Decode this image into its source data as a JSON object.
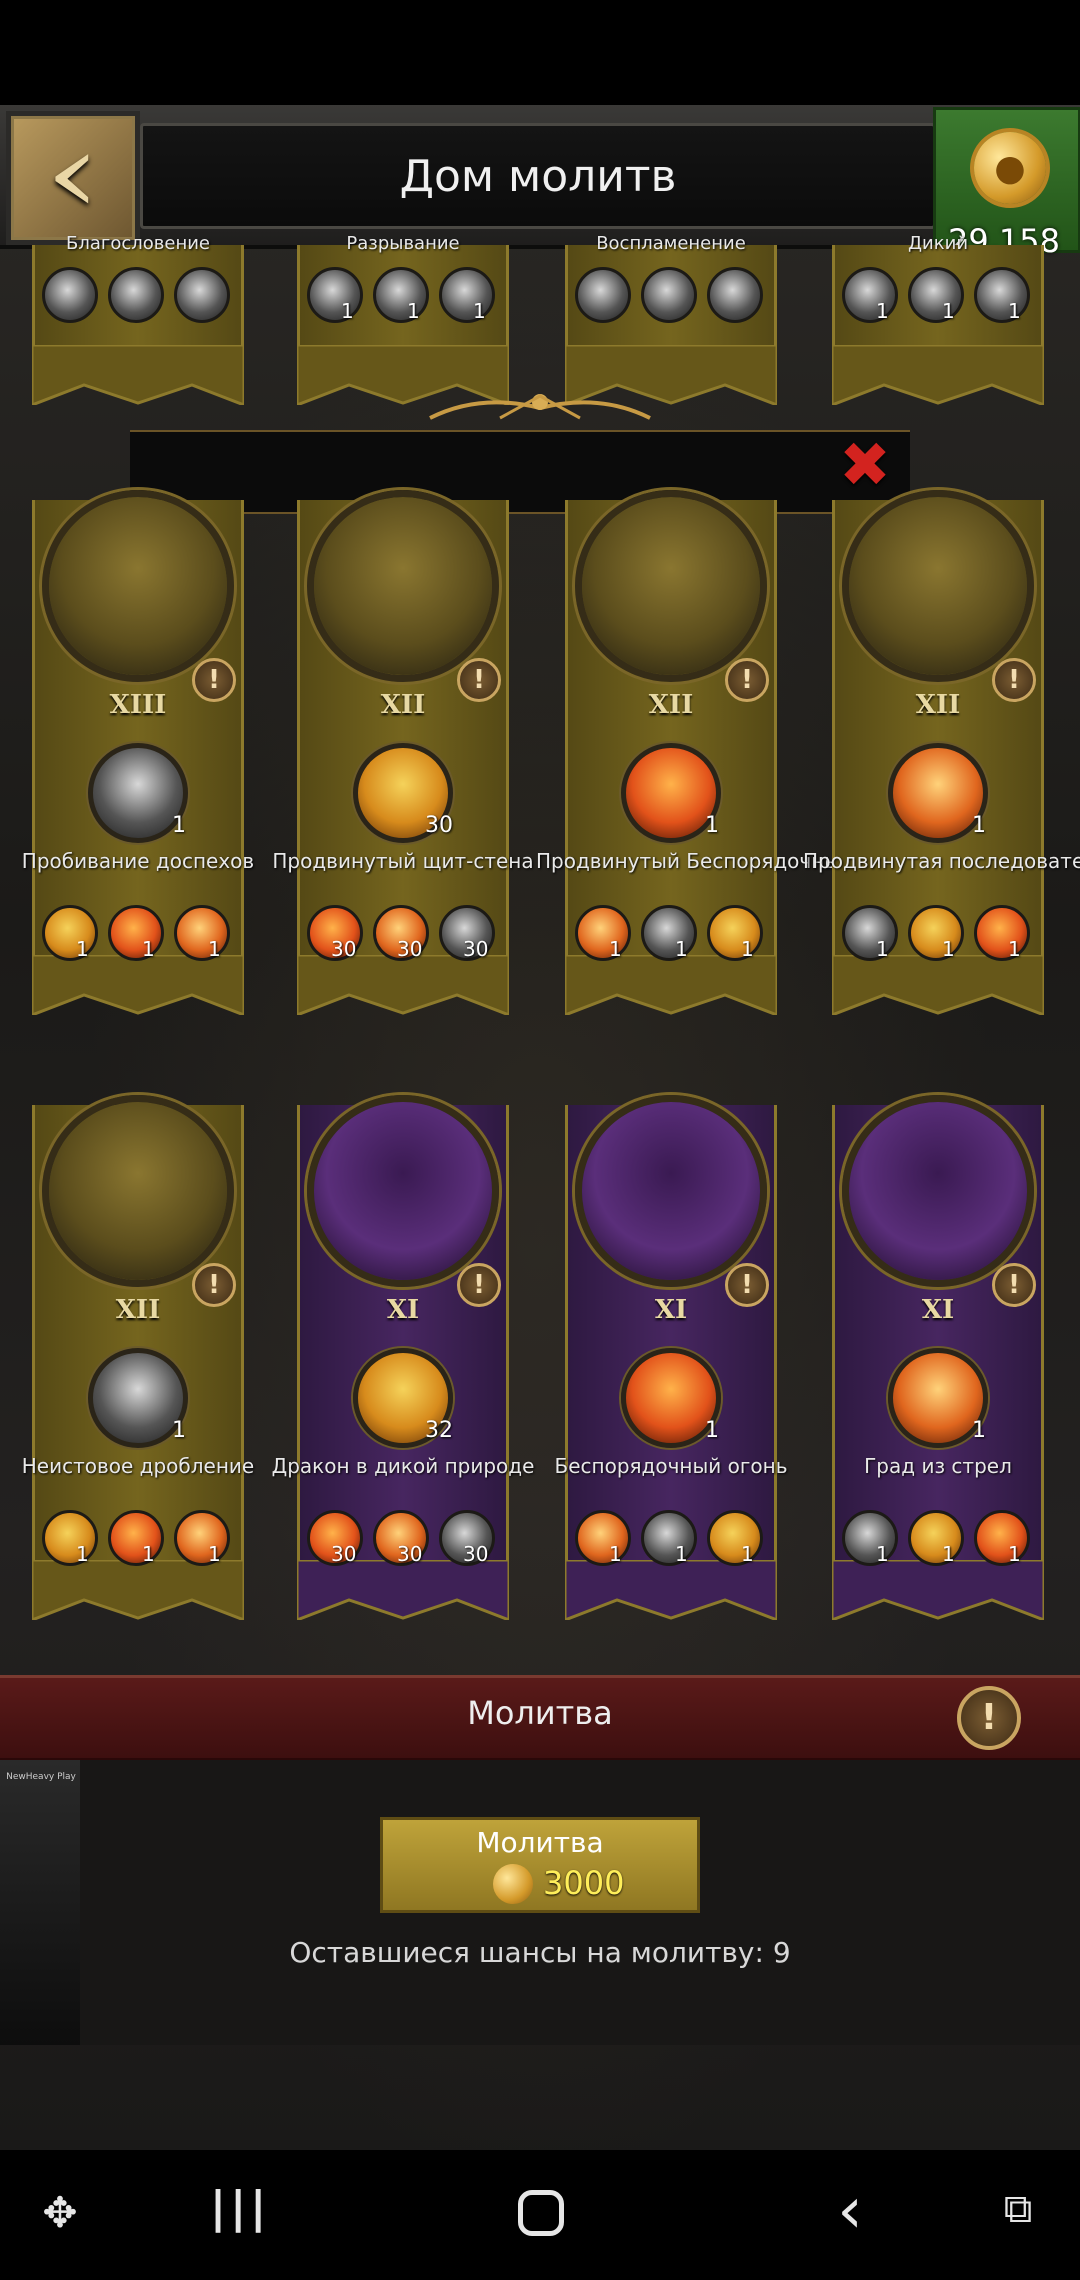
{
  "header": {
    "title": "Дом молитв",
    "gold": "29,158"
  },
  "partial_row": {
    "labels": [
      "Благословение",
      "Разрывание",
      "Воспламенение",
      "Дикий"
    ],
    "counts": [
      [
        "",
        "",
        ""
      ],
      [
        "1",
        "1",
        "1"
      ],
      [
        "",
        "",
        ""
      ],
      [
        "1",
        "1",
        "1"
      ]
    ]
  },
  "heroes": [
    {
      "level": "XIII",
      "skill": "Пробивание доспехов",
      "skill_count": "1",
      "subs": [
        "1",
        "1",
        "1"
      ],
      "theme": "gold"
    },
    {
      "level": "XII",
      "skill": "Продвинутый щит-стена",
      "skill_count": "30",
      "subs": [
        "30",
        "30",
        "30"
      ],
      "theme": "gold"
    },
    {
      "level": "XII",
      "skill": "Продвинутый Беспорядочный",
      "skill_count": "1",
      "subs": [
        "1",
        "1",
        "1"
      ],
      "theme": "gold"
    },
    {
      "level": "XII",
      "skill": "Продвинутая последовательная",
      "skill_count": "1",
      "subs": [
        "1",
        "1",
        "1"
      ],
      "theme": "gold"
    },
    {
      "level": "XII",
      "skill": "Неистовое дробление",
      "skill_count": "1",
      "subs": [
        "1",
        "1",
        "1"
      ],
      "theme": "gold"
    },
    {
      "level": "XI",
      "skill": "Дракон в дикой природе",
      "skill_count": "32",
      "subs": [
        "30",
        "30",
        "30"
      ],
      "theme": "purple"
    },
    {
      "level": "XI",
      "skill": "Беспорядочный огонь",
      "skill_count": "1",
      "subs": [
        "1",
        "1",
        "1"
      ],
      "theme": "purple"
    },
    {
      "level": "XI",
      "skill": "Град из стрел",
      "skill_count": "1",
      "subs": [
        "1",
        "1",
        "1"
      ],
      "theme": "purple"
    }
  ],
  "prayer": {
    "bar_label": "Молитва",
    "button_label": "Молитва",
    "cost": "3000",
    "chances": "Оставшиеся шансы на молитву: 9"
  },
  "side_logo": "NewHeavy Play",
  "colors": {
    "gold_banner": "#75651e",
    "purple_banner": "#472660",
    "prayer_bar": "#5a1a19",
    "accent": "#c9a561"
  }
}
